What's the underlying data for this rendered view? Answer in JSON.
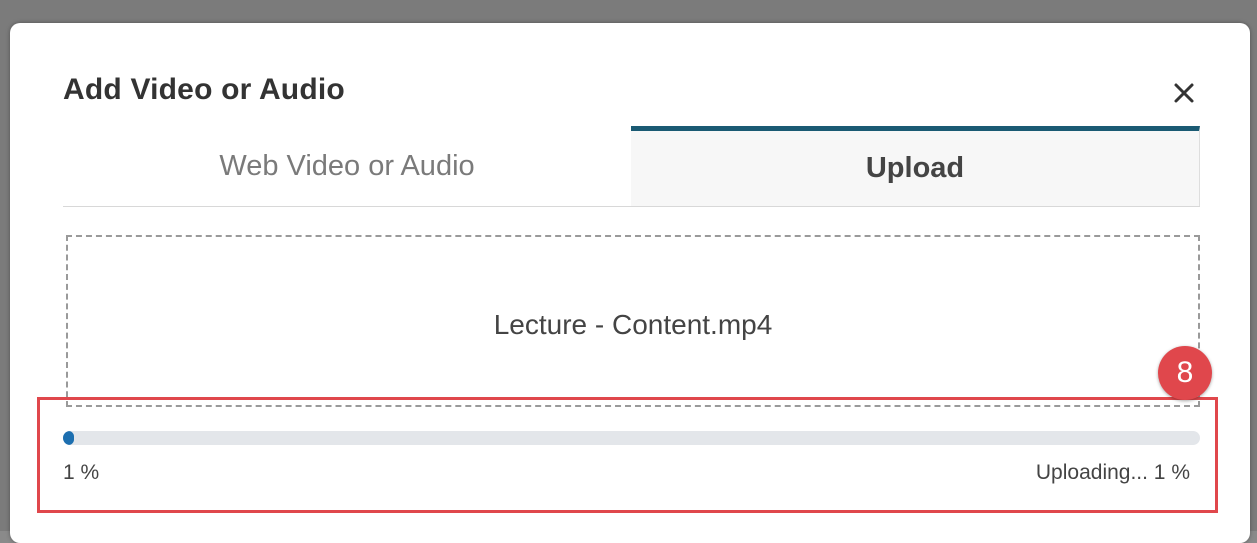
{
  "dialog": {
    "title": "Add Video or Audio",
    "close_icon": "close-icon"
  },
  "tabs": [
    {
      "label": "Web Video or Audio",
      "selected": false
    },
    {
      "label": "Upload",
      "selected": true
    }
  ],
  "upload": {
    "file_name": "Lecture - Content.mp4",
    "progress": 0.01,
    "progress_label": "1 %",
    "status_text": "Uploading... 1 %"
  },
  "annotation": {
    "step_number": "8",
    "color": "#e0474c"
  },
  "colors": {
    "accent": "#1a5a73",
    "progress_fill": "#1d6fb0",
    "progress_track": "#e3e6ea"
  }
}
